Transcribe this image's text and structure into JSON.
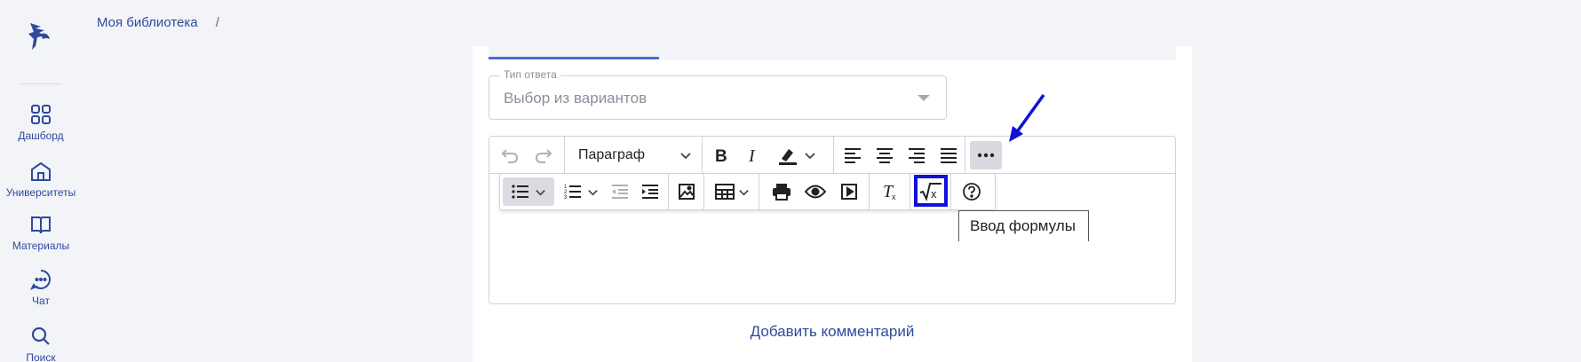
{
  "sidebar": {
    "items": [
      {
        "label": "Дашборд",
        "icon": "dashboard-icon"
      },
      {
        "label": "Университеты",
        "icon": "university-icon"
      },
      {
        "label": "Материалы",
        "icon": "book-icon"
      },
      {
        "label": "Чат",
        "icon": "chat-icon"
      },
      {
        "label": "Поиск",
        "icon": "search-icon"
      }
    ]
  },
  "breadcrumb": {
    "item": "Моя библиотека",
    "separator": "/"
  },
  "answer_type": {
    "legend": "Тип ответа",
    "value": "Выбор из вариантов"
  },
  "editor": {
    "paragraph_label": "Параграф",
    "tooltip": "Ввод формулы"
  },
  "add_comment": "Добавить комментарий",
  "colors": {
    "accent": "#2d4a9c",
    "highlight": "#1010d8",
    "tab_underline": "#4a6fd0"
  }
}
